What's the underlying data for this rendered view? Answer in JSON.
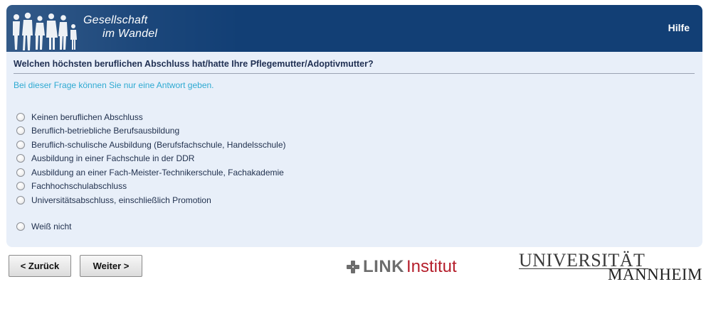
{
  "header": {
    "logo_line1": "Gesellschaft",
    "logo_line2": "im Wandel",
    "help_label": "Hilfe"
  },
  "question": {
    "text": "Welchen höchsten beruflichen Abschluss hat/hatte Ihre Pflegemutter/Adoptivmutter?",
    "instruction": "Bei dieser Frage können Sie nur eine Antwort geben."
  },
  "options": [
    "Keinen beruflichen Abschluss",
    "Beruflich-betriebliche Berufsausbildung",
    "Beruflich-schulische Ausbildung (Berufsfachschule, Handelsschule)",
    "Ausbildung in einer Fachschule in der DDR",
    "Ausbildung an einer Fach-Meister-Technikerschule, Fachakademie",
    "Fachhochschulabschluss",
    "Universitätsabschluss, einschließlich Promotion",
    "Weiß nicht"
  ],
  "navigation": {
    "back_label": "< Zurück",
    "next_label": "Weiter >"
  },
  "footer": {
    "link_bold": "LINK",
    "link_text": "Institut",
    "uni_line1": "UNIVERSITÄT",
    "uni_line2": "MANNHEIM"
  },
  "colors": {
    "header_bg": "#123f75",
    "panel_bg": "#e8eff9",
    "instruction": "#2eaad2",
    "link_red": "#b51e2b"
  }
}
